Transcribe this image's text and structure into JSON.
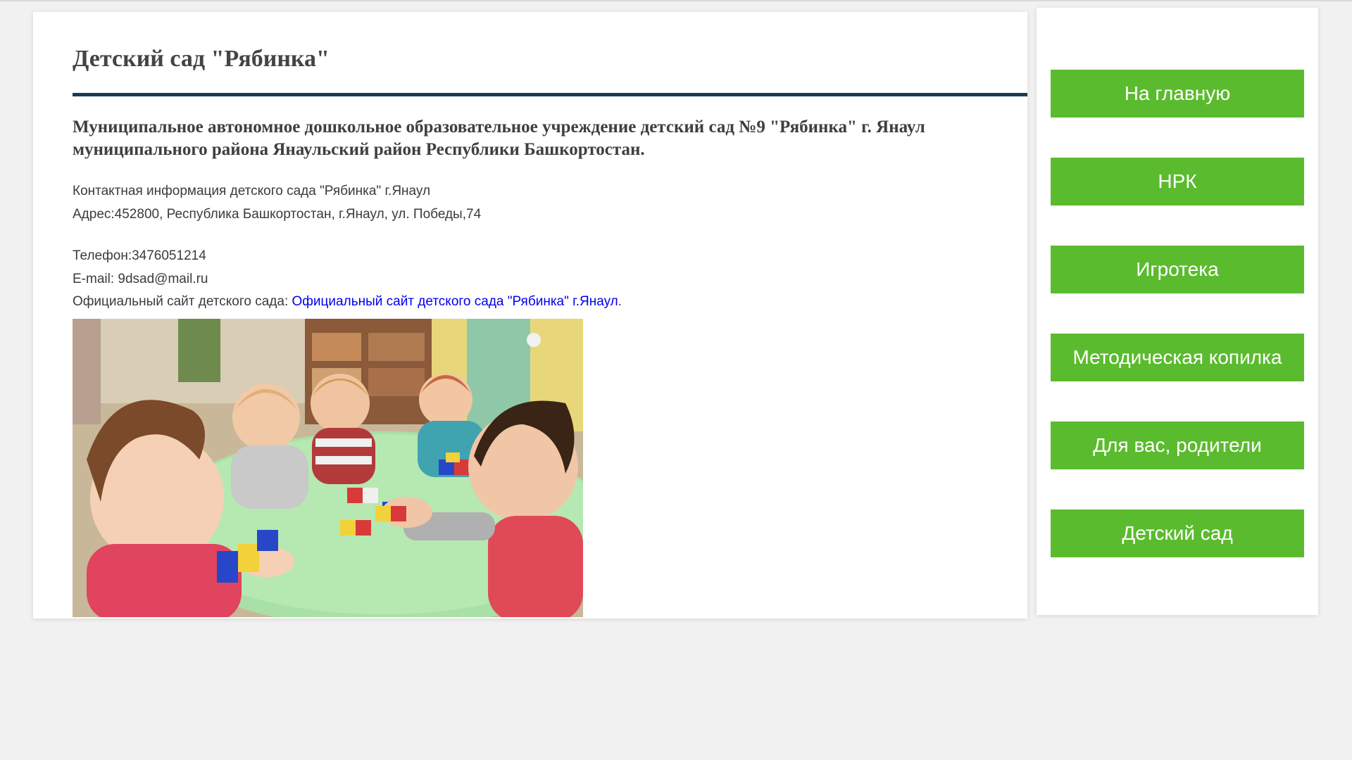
{
  "header": {
    "title": "Детский сад \"Рябинка\""
  },
  "content": {
    "org_name": "Муниципальное автономное дошкольное образовательное учреждение детский сад №9 \"Рябинка\" г. Янаул муниципального района Янаульский район Республики Башкортостан.",
    "contact_heading": "Контактная информация детского сада \"Рябинка\" г.Янаул",
    "address": "Адрес:452800, Республика Башкортостан, г.Янаул, ул. Победы,74",
    "phone": "Телефон:3476051214",
    "email": "E-mail: 9dsad@mail.ru",
    "site_label": "Официальный сайт детского сада: ",
    "site_link": "Официальный сайт детского сада \"Рябинка\" г.Янаул",
    "site_suffix": "."
  },
  "sidebar": {
    "items": [
      {
        "label": "На главную"
      },
      {
        "label": "НРК"
      },
      {
        "label": "Игротека"
      },
      {
        "label": "Методическая копилка"
      },
      {
        "label": "Для вас, родители"
      },
      {
        "label": "Детский сад"
      }
    ]
  },
  "colors": {
    "nav_button": "#5bbb2e",
    "title_rule": "#1d3b52",
    "link": "#0000ee",
    "page_bg": "#f1f1f1"
  }
}
